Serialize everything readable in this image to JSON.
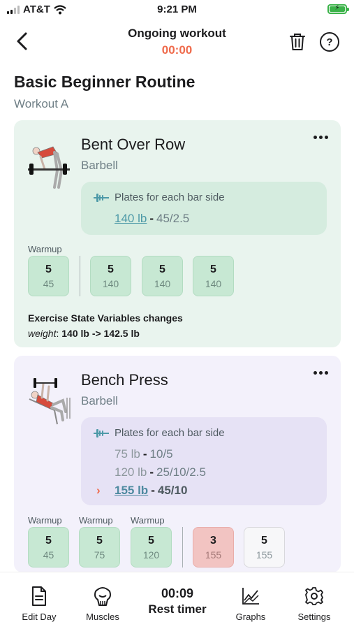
{
  "status_bar": {
    "carrier": "AT&T",
    "time": "9:21 PM"
  },
  "header": {
    "title": "Ongoing workout",
    "timer": "00:00"
  },
  "routine": {
    "title": "Basic Beginner Routine",
    "workout": "Workout A"
  },
  "exercises": [
    {
      "name": "Bent Over Row",
      "equipment": "Barbell",
      "plates_label": "Plates for each bar side",
      "plate_lines": [
        {
          "weight": "140 lb",
          "plates": "45/2.5"
        }
      ],
      "warmup_label": "Warmup",
      "warmup_sets": [
        {
          "reps": "5",
          "weight": "45"
        }
      ],
      "work_sets": [
        {
          "reps": "5",
          "weight": "140"
        },
        {
          "reps": "5",
          "weight": "140"
        },
        {
          "reps": "5",
          "weight": "140"
        }
      ],
      "state_title": "Exercise State Variables changes",
      "state_key": "weight",
      "state_value": "140 lb -> 142.5 lb"
    },
    {
      "name": "Bench Press",
      "equipment": "Barbell",
      "plates_label": "Plates for each bar side",
      "plate_lines": [
        {
          "weight": "75 lb",
          "plates": "10/5"
        },
        {
          "weight": "120 lb",
          "plates": "25/10/2.5"
        },
        {
          "weight": "155 lb",
          "plates": "45/10"
        }
      ],
      "warmup_label": "Warmup",
      "warmup_sets": [
        {
          "reps": "5",
          "weight": "45"
        },
        {
          "reps": "5",
          "weight": "75"
        },
        {
          "reps": "5",
          "weight": "120"
        }
      ],
      "work_sets": [
        {
          "reps": "3",
          "weight": "155"
        },
        {
          "reps": "5",
          "weight": "155"
        }
      ]
    }
  ],
  "tabbar": {
    "edit_day": "Edit Day",
    "muscles": "Muscles",
    "rest_time": "00:09",
    "rest_label": "Rest timer",
    "graphs": "Graphs",
    "settings": "Settings"
  },
  "colors": {
    "accent_timer": "#ef6b4c",
    "card_green": "#e9f4ee",
    "card_purple": "#f3f1fb",
    "set_done": "#c7e8d3",
    "set_failed": "#f2c4c2"
  }
}
